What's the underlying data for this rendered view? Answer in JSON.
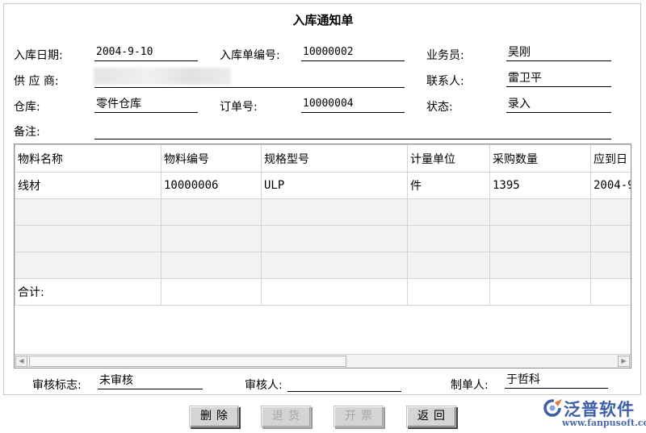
{
  "title": "入库通知单",
  "form": {
    "date_label": "入库日期:",
    "date_value": "2004-9-10",
    "order_no_label": "入库单编号:",
    "order_no_value": "10000002",
    "salesman_label": "业务员:",
    "salesman_value": "吴刚",
    "supplier_label": "供 应 商:",
    "contact_label": "联系人:",
    "contact_value": "雷卫平",
    "warehouse_label": "仓库:",
    "warehouse_value": "零件仓库",
    "po_label": "订单号:",
    "po_value": "10000004",
    "status_label": "状态:",
    "status_value": "录入",
    "remark_label": "备注:"
  },
  "table": {
    "columns": [
      "物料名称",
      "物料编号",
      "规格型号",
      "计量单位",
      "采购数量",
      "应到日"
    ],
    "rows": [
      [
        "线材",
        "10000006",
        "ULP",
        "件",
        "1395",
        "2004-9"
      ]
    ],
    "total_label": "合计:"
  },
  "footer": {
    "audit_flag_label": "审核标志:",
    "audit_flag_value": "未审核",
    "auditor_label": "审核人:",
    "maker_label": "制单人:",
    "maker_value": "于哲科"
  },
  "buttons": {
    "delete": "删除",
    "return_goods": "退货",
    "invoice": "开票",
    "back": "返回"
  },
  "logo": {
    "name": "泛普软件",
    "url": "www.fanpusoft.com",
    "color": "#3c5fa8"
  }
}
